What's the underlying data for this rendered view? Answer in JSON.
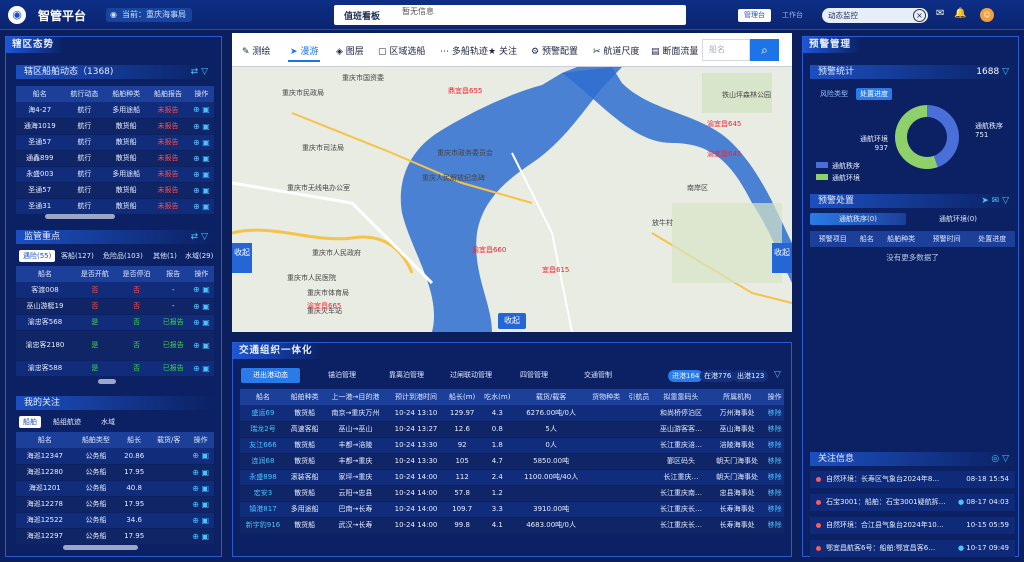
{
  "header": {
    "title": "智管平台",
    "location": "当前：重庆海事局",
    "duty": "值班看板",
    "notice": "暂无信息",
    "btn_workbench_active": "管理台",
    "btn_workspace": "工作台",
    "search_value": "动态监控"
  },
  "left": {
    "title": "辖区态势",
    "ships": {
      "title": "辖区船舶动态（1368)",
      "cols": [
        "船名",
        "航行动态",
        "船舶种类",
        "船舶报告",
        "操作"
      ],
      "rows": [
        [
          "海4-27",
          "航行",
          "多用途船",
          "未报告"
        ],
        [
          "通海1019",
          "航行",
          "散货船",
          "未报告"
        ],
        [
          "圣通57",
          "航行",
          "散货船",
          "未报告"
        ],
        [
          "通鑫899",
          "航行",
          "散货船",
          "未报告"
        ],
        [
          "永盛003",
          "航行",
          "多用途船",
          "未报告"
        ],
        [
          "圣通57",
          "航行",
          "散货船",
          "未报告"
        ],
        [
          "圣通31",
          "航行",
          "散货船",
          "未报告"
        ]
      ]
    },
    "focus": {
      "title": "监管重点",
      "tabs": [
        "遇险(55)",
        "客船(127)",
        "危险品(103)",
        "其他(1)",
        "水域(29)"
      ],
      "cols": [
        "船名",
        "是否开航",
        "是否停泊",
        "报告",
        "操作"
      ],
      "rows": [
        [
          "客渡008",
          "否",
          "否",
          "-"
        ],
        [
          "巫山游艇19",
          "否",
          "否",
          "-"
        ],
        [
          "渝忠客568",
          "是",
          "否",
          "已报告"
        ],
        [
          "渝忠客2180",
          "是",
          "否",
          "已报告"
        ],
        [
          "渝忠客588",
          "是",
          "否",
          "已报告"
        ]
      ]
    },
    "mine": {
      "title": "我的关注",
      "tabs": [
        "船舶",
        "船组航迹",
        "水域"
      ],
      "cols": [
        "船名",
        "船舶类型",
        "船长",
        "载货/客",
        "操作"
      ],
      "rows": [
        [
          "海巡12347",
          "公务船",
          "20.86",
          ""
        ],
        [
          "海巡12280",
          "公务船",
          "17.95",
          ""
        ],
        [
          "海巡1201",
          "公务船",
          "40.8",
          ""
        ],
        [
          "海巡12278",
          "公务船",
          "17.95",
          ""
        ],
        [
          "海巡12522",
          "公务船",
          "34.6",
          ""
        ],
        [
          "海巡12297",
          "公务船",
          "17.95",
          ""
        ]
      ]
    }
  },
  "map": {
    "tools": [
      "测绘",
      "漫游",
      "图层",
      "区域选船",
      "多船轨迹",
      "关注",
      "预警配置",
      "航道尺度",
      "断面流量"
    ],
    "search_placeholder": "船名",
    "collapse_left": "收起",
    "collapse_right": "收起",
    "collapse_bottom": "收起",
    "labels": [
      "重庆市民政局",
      "重庆市国资委",
      "重庆市人民政府",
      "重庆市无线电办公室",
      "重庆市人民医院",
      "重庆市体育局",
      "重庆火车站",
      "重庆市政务委员会",
      "重庆人民解放纪念碑",
      "重庆市司法局",
      "南岸区",
      "放牛村",
      "铁山坪森林公园"
    ],
    "ship_labels": [
      "鼎宜昌655",
      "渝宜昌645",
      "渝宜昌645",
      "渝宜昌660",
      "渝宜昌665",
      "宜昌615"
    ]
  },
  "traffic": {
    "title": "交通组织一体化",
    "tabs": [
      "进出港动态",
      "锚泊管理",
      "靠离泊管理",
      "过闸联动管理",
      "四管管理",
      "交通管制"
    ],
    "stats": [
      "进港164",
      "在港776",
      "出港123"
    ],
    "cols": [
      "船名",
      "船舶种类",
      "上一港→目的港",
      "预计到港时间",
      "船长(m)",
      "吃水(m)",
      "载货/载客",
      "货物种类",
      "引航员",
      "拟靠靠码头",
      "所属机构",
      "操作"
    ],
    "rows": [
      [
        "盛运69",
        "散货船",
        "南京→重庆万州",
        "10-24 13:10",
        "129.97",
        "4.3",
        "6276.00吨/0人",
        "",
        "",
        "和尚桥停泊区",
        "万州海事处",
        "移除"
      ],
      [
        "瑞龙2号",
        "高速客船",
        "巫山→巫山",
        "10-24 13:27",
        "12.6",
        "0.8",
        "5人",
        "",
        "",
        "巫山游客客…",
        "巫山海事处",
        "移除"
      ],
      [
        "友江666",
        "散货船",
        "丰都→涪陵",
        "10-24 13:30",
        "92",
        "1.8",
        "0人",
        "",
        "",
        "长江重庆涪…",
        "涪陵海事处",
        "移除"
      ],
      [
        "连润68",
        "散货船",
        "丰都→重庆",
        "10-24 13:30",
        "105",
        "4.7",
        "5850.00吨",
        "",
        "",
        "鄞区码头",
        "朝天门海事处",
        "移除"
      ],
      [
        "永盛898",
        "滚装客船",
        "家坪→重庆",
        "10-24 14:00",
        "112",
        "2.4",
        "1100.00吨/40人",
        "",
        "",
        "长江重庆…",
        "朝天门海事处",
        "移除"
      ],
      [
        "宏安3",
        "散货船",
        "云阳→忠县",
        "10-24 14:00",
        "57.8",
        "1.2",
        "",
        "",
        "",
        "长江重庆南…",
        "忠县海事处",
        "移除"
      ],
      [
        "镇港817",
        "多用途船",
        "巴南→长寿",
        "10-24 14:00",
        "109.7",
        "3.3",
        "3910.00吨",
        "",
        "",
        "长江重庆长…",
        "长寿海事处",
        "移除"
      ],
      [
        "新宇豹916",
        "散货船",
        "武汉→长寿",
        "10-24 14:00",
        "99.8",
        "4.1",
        "4683.00吨/0人",
        "",
        "",
        "长江重庆长…",
        "长寿海事处",
        "移除"
      ]
    ]
  },
  "right": {
    "title": "预警管理",
    "stats": {
      "title": "预警统计",
      "total": "1688",
      "tabs": [
        "风险类型",
        "处置进度"
      ],
      "slices": [
        {
          "name": "通航秩序",
          "value": 751,
          "color": "#4a6fd8"
        },
        {
          "name": "通航环境",
          "value": 937,
          "color": "#8ed06a"
        }
      ],
      "label_a": "通航秩序",
      "label_a_val": "751",
      "label_b": "通航环境",
      "label_b_val": "937"
    },
    "handle": {
      "title": "预警处置",
      "tabs": [
        "通航秩序(0)",
        "通航环境(0)"
      ],
      "cols": [
        "预警项目",
        "船名",
        "船舶种类",
        "预警时间",
        "处置进度"
      ],
      "empty": "没有更多数据了"
    },
    "info": {
      "title": "关注信息",
      "items": [
        {
          "text": "自然环境：长寿区气象台2024年8…",
          "time": "08-18 15:54"
        },
        {
          "text": "石宝3001：船舶：石宝3001疑航拆…",
          "time": "08-17 04:03"
        },
        {
          "text": "自然环境：合江县气象台2024年10…",
          "time": "10-15 05:59"
        },
        {
          "text": "鄂宜昌航客6号：船舶:鄂宜昌客6…",
          "time": "10-17 09:49"
        }
      ]
    }
  }
}
